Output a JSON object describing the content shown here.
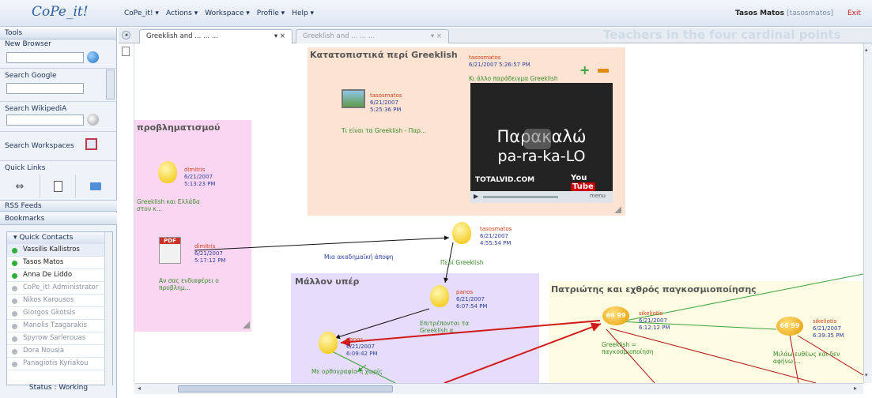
{
  "app": {
    "logo": "CoPe_it!",
    "menu": [
      "CoPe_it! ▾",
      "Actions ▾",
      "Workspace ▾",
      "Profile ▾",
      "Help ▾"
    ],
    "user_name": "Tasos Matos",
    "user_nick": "[tasosmatos]",
    "exit": "Exit"
  },
  "sidebar": {
    "tools": "Tools",
    "new_browser": "New Browser",
    "search_google": "Search Google",
    "search_wikipedia": "Search WikipediA",
    "search_workspaces": "Search Workspaces",
    "quick_links": "Quick Links",
    "rss": "RSS Feeds",
    "bookmarks": "Bookmarks",
    "quick_contacts": "▾ Quick Contacts",
    "status": "Status : Working",
    "contacts": [
      {
        "name": "Vassilis Kallistros",
        "online": true
      },
      {
        "name": "Tasos Matos",
        "online": true
      },
      {
        "name": "Anna De Liddo",
        "online": true
      },
      {
        "name": "CoPe_it! Administrator",
        "online": false
      },
      {
        "name": "Nikos Karousos",
        "online": false
      },
      {
        "name": "Giorgos Gkotsis",
        "online": false
      },
      {
        "name": "Manolis Tzagarakis",
        "online": false
      },
      {
        "name": "Spyrow Sarlerouas",
        "online": false
      },
      {
        "name": "Dora Nousia",
        "online": false
      },
      {
        "name": "Panagiotis Kyriakou",
        "online": false
      }
    ]
  },
  "tabs": [
    {
      "label": "Greeklish and ... ... ...",
      "close": "▾ ×"
    },
    {
      "label": "Greeklish and ... ... ...",
      "close": "▾ ×"
    }
  ],
  "workspace_title": "Teachers in the four cardinal points",
  "regions": {
    "r1": "Κατατοπιστικά περί Greeklish",
    "r2": "προβληματισμού",
    "r3": "Μάλλον υπέρ",
    "r4": "Πατριώτης και εχθρός παγκοσμιοποίησης"
  },
  "video": {
    "line1": "Παρακαλώ",
    "line2": "pa-ra-ka-LO",
    "brand": "TOTALVID.COM",
    "yt1": "You",
    "yt2": "Tube",
    "menu": "menu"
  },
  "nodes": {
    "n_video": {
      "author": "tasosmatos",
      "date": "6/21/2007",
      "time": "5:26:57 PM",
      "text": "Κι άλλο παράδειγμα Greeklish"
    },
    "n_doc": {
      "author": "tasosmatos",
      "date": "6/21/2007",
      "time": "5:25:36 PM",
      "text": "Τι είναι τα Greeklish - Παρ..."
    },
    "n_dimitris1": {
      "author": "dimitris",
      "date": "6/21/2007",
      "time": "5:13:23 PM",
      "text": "Greeklish και Ελλάδα στον κ..."
    },
    "n_pdf": {
      "author": "dimitris",
      "date": "6/21/2007",
      "time": "5:17:12 PM",
      "text": "Αν σας ενδιαφέρει ο προβλημ..."
    },
    "n_peri": {
      "author": "tasosmatos",
      "date": "6/21/2007",
      "time": "4:55:54 PM",
      "text": "Περί Greeklish"
    },
    "n_panos1": {
      "author": "panos",
      "date": "6/21/2007",
      "time": "6:07:54 PM",
      "text": "Επιτρέπονται τα Greeklish α..."
    },
    "n_panos2": {
      "author": "panos",
      "date": "6/21/2007",
      "time": "6:09:42 PM",
      "text": "Με ορθογραφία ή χωρίς"
    },
    "n_sik1": {
      "author": "sikeliotis",
      "date": "6/21/2007",
      "time": "6:12:12 PM",
      "text": "Greeklish = παγκοσμιοποίηση"
    },
    "n_sik2": {
      "author": "sikeliotis",
      "date": "6/21/2007",
      "time": "6:39:35 PM",
      "text": "Μιλάω ευθέως και δεν αφήνω ..."
    }
  },
  "edge_label": "Μια ακαδημαϊκή άποψη",
  "colors": {
    "pink": "#fbd6f2",
    "peach": "#fde3d2",
    "lavender": "#e6dcfb",
    "cream": "#fdfbe2",
    "meta": "#2b3f9c",
    "author": "#d0421b",
    "text": "#3a8a2c"
  }
}
